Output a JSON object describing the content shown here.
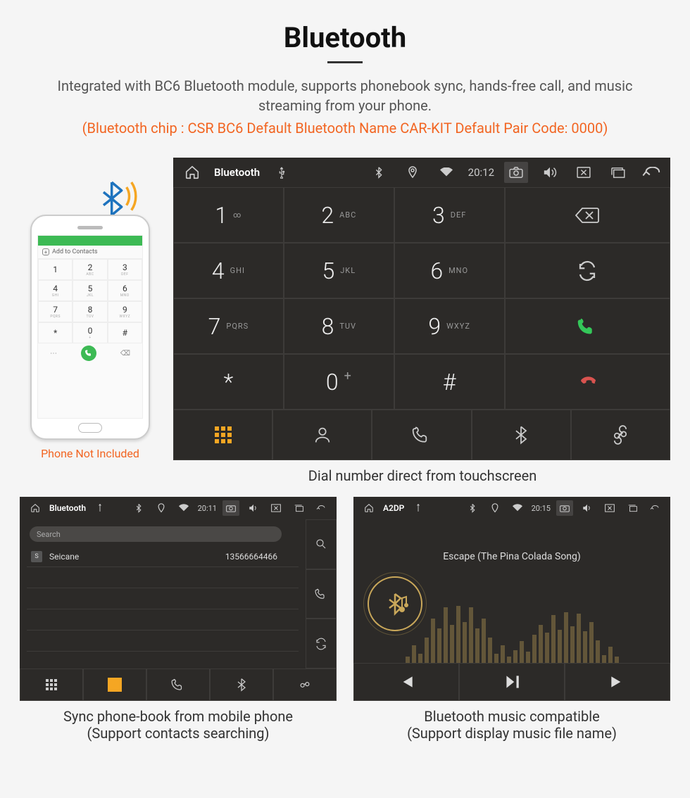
{
  "header": {
    "title": "Bluetooth",
    "desc": "Integrated with BC6 Bluetooth module, supports phonebook sync, hands-free call, and music streaming from your phone.",
    "spec": "(Bluetooth chip : CSR BC6     Default Bluetooth Name CAR-KIT     Default Pair Code: 0000)"
  },
  "phone_mock": {
    "add_contacts": "Add to Contacts",
    "note": "Phone Not Included",
    "keys": [
      {
        "n": "1",
        "s": ""
      },
      {
        "n": "2",
        "s": "ABC"
      },
      {
        "n": "3",
        "s": "DEF"
      },
      {
        "n": "4",
        "s": "GHI"
      },
      {
        "n": "5",
        "s": "JKL"
      },
      {
        "n": "6",
        "s": "MNO"
      },
      {
        "n": "7",
        "s": "PQRS"
      },
      {
        "n": "8",
        "s": "TUV"
      },
      {
        "n": "9",
        "s": "WXYZ"
      },
      {
        "n": "*",
        "s": ""
      },
      {
        "n": "0",
        "s": "+"
      },
      {
        "n": "#",
        "s": ""
      }
    ]
  },
  "dialer": {
    "title": "Bluetooth",
    "time": "20:12",
    "keys": [
      {
        "n": "1",
        "s": "∞"
      },
      {
        "n": "2",
        "s": "ABC"
      },
      {
        "n": "3",
        "s": "DEF"
      },
      {
        "n": "4",
        "s": "GHI"
      },
      {
        "n": "5",
        "s": "JKL"
      },
      {
        "n": "6",
        "s": "MNO"
      },
      {
        "n": "7",
        "s": "PQRS"
      },
      {
        "n": "8",
        "s": "TUV"
      },
      {
        "n": "9",
        "s": "WXYZ"
      },
      {
        "n": "*",
        "s": ""
      },
      {
        "n": "0",
        "s": "+"
      },
      {
        "n": "#",
        "s": ""
      }
    ],
    "caption": "Dial number direct from touchscreen"
  },
  "phonebook": {
    "title": "Bluetooth",
    "time": "20:11",
    "search_placeholder": "Search",
    "contact_initial": "S",
    "contact_name": "Seicane",
    "contact_number": "13566664466",
    "caption_l1": "Sync phone-book from mobile phone",
    "caption_l2": "(Support contacts searching)"
  },
  "a2dp": {
    "title": "A2DP",
    "time": "20:15",
    "song": "Escape (The Pina Colada Song)",
    "caption_l1": "Bluetooth music compatible",
    "caption_l2": "(Support display music file name)"
  }
}
